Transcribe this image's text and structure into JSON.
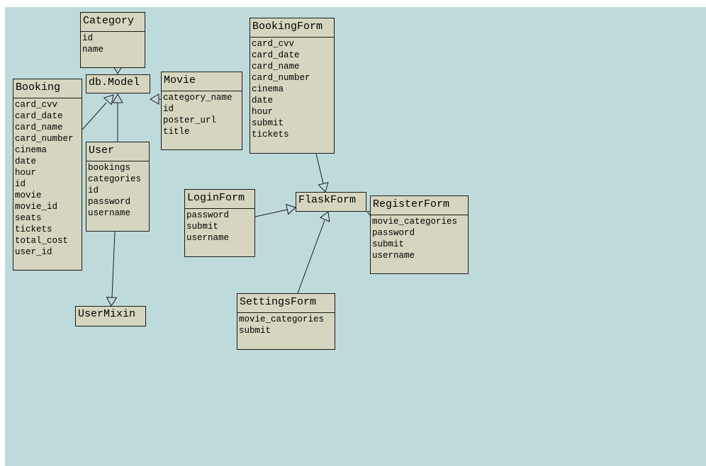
{
  "diagram": {
    "classes": {
      "category": {
        "name": "Category",
        "attributes": [
          "id",
          "name"
        ]
      },
      "db_model": {
        "name": "db.Model",
        "attributes": []
      },
      "movie": {
        "name": "Movie",
        "attributes": [
          "category_name",
          "id",
          "poster_url",
          "title"
        ]
      },
      "booking": {
        "name": "Booking",
        "attributes": [
          "card_cvv",
          "card_date",
          "card_name",
          "card_number",
          "cinema",
          "date",
          "hour",
          "id",
          "movie",
          "movie_id",
          "seats",
          "tickets",
          "total_cost",
          "user_id"
        ]
      },
      "user": {
        "name": "User",
        "attributes": [
          "bookings",
          "categories",
          "id",
          "password",
          "username"
        ]
      },
      "user_mixin": {
        "name": "UserMixin",
        "attributes": []
      },
      "booking_form": {
        "name": "BookingForm",
        "attributes": [
          "card_cvv",
          "card_date",
          "card_name",
          "card_number",
          "cinema",
          "date",
          "hour",
          "submit",
          "tickets"
        ]
      },
      "flask_form": {
        "name": "FlaskForm",
        "attributes": []
      },
      "login_form": {
        "name": "LoginForm",
        "attributes": [
          "password",
          "submit",
          "username"
        ]
      },
      "register_form": {
        "name": "RegisterForm",
        "attributes": [
          "movie_categories",
          "password",
          "submit",
          "username"
        ]
      },
      "settings_form": {
        "name": "SettingsForm",
        "attributes": [
          "movie_categories",
          "submit"
        ]
      }
    },
    "inheritance": [
      {
        "from": "Category",
        "to": "db.Model"
      },
      {
        "from": "Booking",
        "to": "db.Model"
      },
      {
        "from": "User",
        "to": "db.Model"
      },
      {
        "from": "Movie",
        "to": "db.Model"
      },
      {
        "from": "User",
        "to": "UserMixin"
      },
      {
        "from": "BookingForm",
        "to": "FlaskForm"
      },
      {
        "from": "LoginForm",
        "to": "FlaskForm"
      },
      {
        "from": "RegisterForm",
        "to": "FlaskForm"
      },
      {
        "from": "SettingsForm",
        "to": "FlaskForm"
      }
    ]
  }
}
